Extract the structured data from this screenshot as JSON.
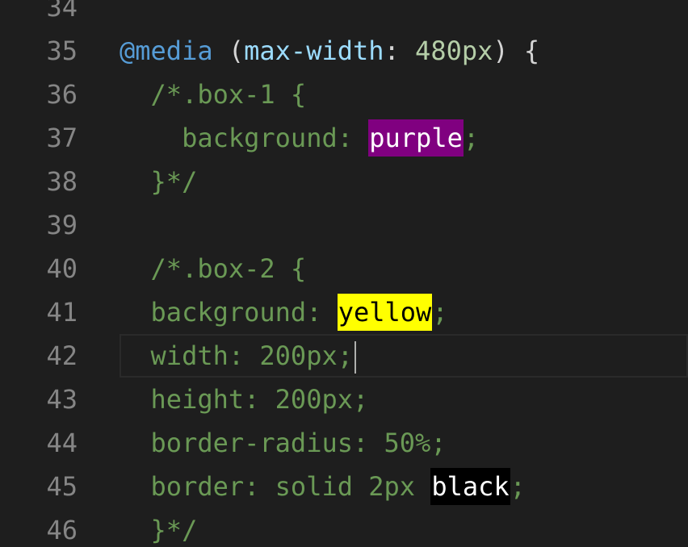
{
  "editor": {
    "line_numbers": [
      "34",
      "35",
      "36",
      "37",
      "38",
      "39",
      "40",
      "41",
      "42",
      "43",
      "44",
      "45",
      "46"
    ],
    "line34": {
      "text": ""
    },
    "line35": {
      "at_media": "@media",
      "open_paren": " (",
      "feature": "max-width",
      "colon": ": ",
      "value": "480px",
      "close": ") {"
    },
    "line36": {
      "indent": "  ",
      "text": "/*.box-1 {"
    },
    "line37": {
      "indent": "    ",
      "prefix": "background: ",
      "color_word": "purple",
      "suffix": ";"
    },
    "line38": {
      "indent": "  ",
      "text": "}*/"
    },
    "line39": {
      "text": ""
    },
    "line40": {
      "indent": "  ",
      "text": "/*.box-2 {"
    },
    "line41": {
      "indent": "  ",
      "prefix": "background: ",
      "color_word": "yellow",
      "suffix": ";"
    },
    "line42": {
      "indent": "  ",
      "text": "width: 200px;"
    },
    "line43": {
      "indent": "  ",
      "text": "height: 200px;"
    },
    "line44": {
      "indent": "  ",
      "text": "border-radius: 50%;"
    },
    "line45": {
      "indent": "  ",
      "prefix": "border: solid 2px ",
      "color_word": "black",
      "suffix": ";"
    },
    "line46": {
      "indent": "  ",
      "text": "}*/"
    },
    "current_line": "42",
    "colors": {
      "background": "#1e1e1e",
      "line_number": "#858585",
      "keyword": "#569cd6",
      "property": "#9cdcfe",
      "number": "#b5cea8",
      "comment": "#6a9955",
      "purple_swatch": "#800080",
      "yellow_swatch": "#ffff00",
      "black_swatch": "#000000"
    }
  }
}
